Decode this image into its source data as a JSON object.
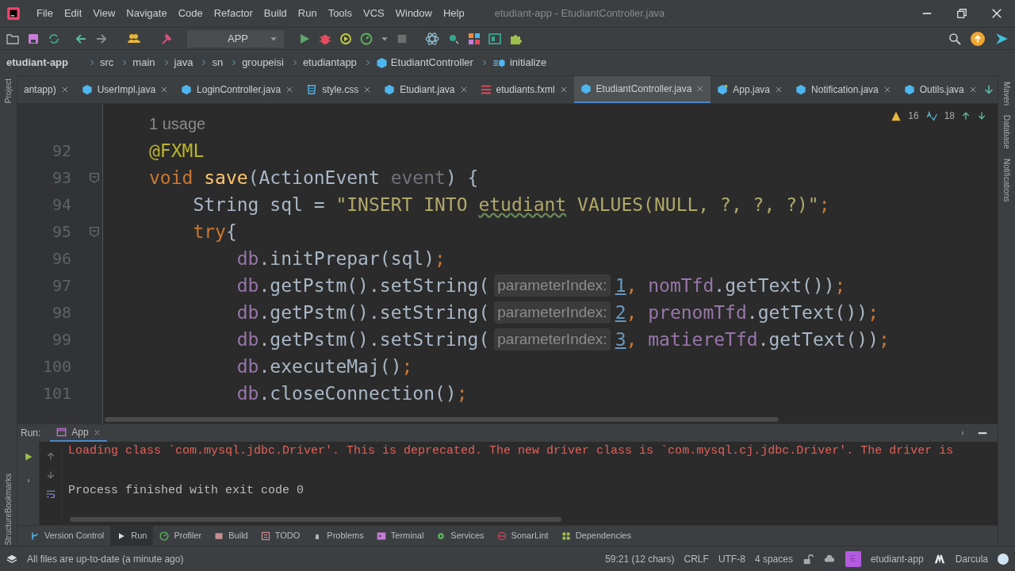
{
  "window": {
    "title": "etudiant-app - EtudiantController.java"
  },
  "menu": [
    "File",
    "Edit",
    "View",
    "Navigate",
    "Code",
    "Refactor",
    "Build",
    "Run",
    "Tools",
    "VCS",
    "Window",
    "Help"
  ],
  "toolbar": {
    "run_config": "APP"
  },
  "breadcrumbs": [
    {
      "label": "etudiant-app",
      "kind": "project"
    },
    {
      "label": "src",
      "kind": "folder"
    },
    {
      "label": "main",
      "kind": "folder"
    },
    {
      "label": "java",
      "kind": "folder"
    },
    {
      "label": "sn",
      "kind": "folder"
    },
    {
      "label": "groupeisi",
      "kind": "folder"
    },
    {
      "label": "etudiantapp",
      "kind": "folder"
    },
    {
      "label": "EtudiantController",
      "kind": "class"
    },
    {
      "label": "initialize",
      "kind": "method"
    }
  ],
  "tabs": [
    {
      "label": "antapp)",
      "kind": "cut",
      "selected": false
    },
    {
      "label": "UserImpl.java",
      "kind": "class",
      "selected": false
    },
    {
      "label": "LoginController.java",
      "kind": "class",
      "selected": false
    },
    {
      "label": "style.css",
      "kind": "css",
      "selected": false
    },
    {
      "label": "Etudiant.java",
      "kind": "class",
      "selected": false
    },
    {
      "label": "etudiants.fxml",
      "kind": "fxml",
      "selected": false
    },
    {
      "label": "EtudiantController.java",
      "kind": "class",
      "selected": true
    },
    {
      "label": "App.java",
      "kind": "app",
      "selected": false
    },
    {
      "label": "Notification.java",
      "kind": "class",
      "selected": false
    },
    {
      "label": "Outils.java",
      "kind": "class",
      "selected": false
    }
  ],
  "left_strip": [
    "Project",
    "Bookmarks",
    "Structure"
  ],
  "right_strip": [
    "Maven",
    "Database",
    "Notifications"
  ],
  "editor": {
    "warnings": "16",
    "typos": "18",
    "usage_hint": "1 usage",
    "lines": [
      {
        "number": "92",
        "fold": false,
        "tokens": [
          {
            "kind": "annotation",
            "text": "@FXML"
          }
        ]
      },
      {
        "number": "93",
        "fold": true,
        "tokens": [
          {
            "kind": "keyword",
            "text": "void "
          },
          {
            "kind": "method",
            "text": "save"
          },
          {
            "kind": "plain",
            "text": "(ActionEvent "
          },
          {
            "kind": "param",
            "text": "event"
          },
          {
            "kind": "plain",
            "text": ") {"
          }
        ],
        "children": [
          {
            "number": "94",
            "fold": false,
            "tokens": [
              {
                "kind": "plain",
                "text": "String sql = "
              },
              {
                "kind": "string",
                "text": "\"INSERT INTO "
              },
              {
                "kind": "typo",
                "text": "etudiant"
              },
              {
                "kind": "string",
                "text": " VALUES(NULL, ?, ?, ?)\""
              },
              {
                "kind": "punct",
                "text": ";"
              }
            ]
          },
          {
            "number": "95",
            "fold": true,
            "tokens": [
              {
                "kind": "keyword",
                "text": "try"
              },
              {
                "kind": "plain",
                "text": "{"
              }
            ],
            "children": [
              {
                "number": "96",
                "fold": false,
                "tokens": [
                  {
                    "kind": "field",
                    "text": "db"
                  },
                  {
                    "kind": "plain",
                    "text": ".initPrepar(sql)"
                  },
                  {
                    "kind": "punct",
                    "text": ";"
                  }
                ]
              },
              {
                "number": "97",
                "fold": false,
                "tokens": [
                  {
                    "kind": "field",
                    "text": "db"
                  },
                  {
                    "kind": "plain",
                    "text": ".getPstm().setString("
                  },
                  {
                    "kind": "hint",
                    "text": "parameterIndex:"
                  },
                  {
                    "kind": "number",
                    "text": "1"
                  },
                  {
                    "kind": "punct",
                    "text": ", "
                  },
                  {
                    "kind": "field",
                    "text": "nomTfd"
                  },
                  {
                    "kind": "plain",
                    "text": ".getText())"
                  },
                  {
                    "kind": "punct",
                    "text": ";"
                  }
                ]
              },
              {
                "number": "98",
                "fold": false,
                "tokens": [
                  {
                    "kind": "field",
                    "text": "db"
                  },
                  {
                    "kind": "plain",
                    "text": ".getPstm().setString("
                  },
                  {
                    "kind": "hint",
                    "text": "parameterIndex:"
                  },
                  {
                    "kind": "number",
                    "text": "2"
                  },
                  {
                    "kind": "punct",
                    "text": ", "
                  },
                  {
                    "kind": "field",
                    "text": "prenomTfd"
                  },
                  {
                    "kind": "plain",
                    "text": ".getText())"
                  },
                  {
                    "kind": "punct",
                    "text": ";"
                  }
                ]
              },
              {
                "number": "99",
                "fold": false,
                "tokens": [
                  {
                    "kind": "field",
                    "text": "db"
                  },
                  {
                    "kind": "plain",
                    "text": ".getPstm().setString("
                  },
                  {
                    "kind": "hint",
                    "text": "parameterIndex:"
                  },
                  {
                    "kind": "number",
                    "text": "3"
                  },
                  {
                    "kind": "punct",
                    "text": ", "
                  },
                  {
                    "kind": "field",
                    "text": "matiereTfd"
                  },
                  {
                    "kind": "plain",
                    "text": ".getText())"
                  },
                  {
                    "kind": "punct",
                    "text": ";"
                  }
                ]
              },
              {
                "number": "100",
                "fold": false,
                "tokens": [
                  {
                    "kind": "field",
                    "text": "db"
                  },
                  {
                    "kind": "plain",
                    "text": ".executeMaj()"
                  },
                  {
                    "kind": "punct",
                    "text": ";"
                  }
                ]
              },
              {
                "number": "101",
                "fold": false,
                "tokens": [
                  {
                    "kind": "field",
                    "text": "db"
                  },
                  {
                    "kind": "plain",
                    "text": ".closeConnection()"
                  },
                  {
                    "kind": "punct",
                    "text": ";"
                  }
                ]
              }
            ]
          }
        ]
      }
    ]
  },
  "run_panel": {
    "label": "Run:",
    "tab": "App",
    "console": [
      {
        "kind": "error",
        "text": "Loading class `com.mysql.jdbc.Driver'. This is deprecated. The new driver class is `com.mysql.cj.jdbc.Driver'. The driver is"
      },
      {
        "kind": "blank"
      },
      {
        "kind": "normal",
        "text": "Process finished with exit code 0"
      }
    ]
  },
  "tool_windows": [
    {
      "label": "Version Control",
      "selected": false
    },
    {
      "label": "Run",
      "selected": true
    },
    {
      "label": "Profiler",
      "selected": false
    },
    {
      "label": "Build",
      "selected": false
    },
    {
      "label": "TODO",
      "selected": false
    },
    {
      "label": "Problems",
      "selected": false
    },
    {
      "label": "Terminal",
      "selected": false
    },
    {
      "label": "Services",
      "selected": false
    },
    {
      "label": "SonarLint",
      "selected": false
    },
    {
      "label": "Dependencies",
      "selected": false
    }
  ],
  "status_bar": {
    "message": "All files are up-to-date (a minute ago)",
    "position": "59:21 (12 chars)",
    "line_separator": "CRLF",
    "encoding": "UTF-8",
    "indent": "4 spaces",
    "project_badge": "E",
    "project": "etudiant-app",
    "theme": "Darcula"
  }
}
